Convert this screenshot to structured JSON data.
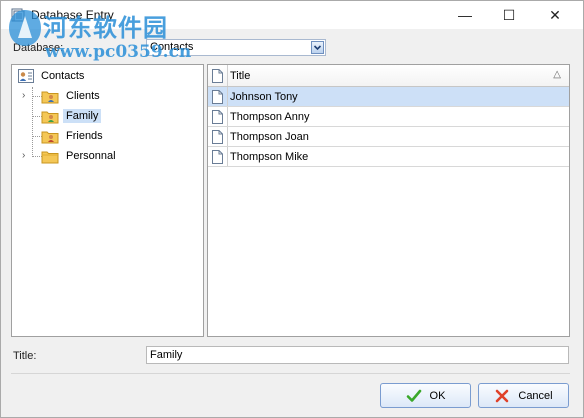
{
  "window": {
    "title": "Database Entry",
    "controls": {
      "minimize": "—",
      "maximize": "☐",
      "close": "✕"
    }
  },
  "watermark": {
    "cn_text": "河东软件园",
    "url": "www.pc0359.cn"
  },
  "database": {
    "label": "Database:",
    "selected": "Contacts"
  },
  "tree": {
    "root": {
      "label": "Contacts",
      "icon": "contacts-icon"
    },
    "children": [
      {
        "label": "Clients",
        "icon": "folder-group-icon",
        "expandable": true,
        "selected": false
      },
      {
        "label": "Family",
        "icon": "folder-group-icon",
        "expandable": false,
        "selected": true
      },
      {
        "label": "Friends",
        "icon": "folder-group-icon",
        "expandable": false,
        "selected": false
      },
      {
        "label": "Personnal",
        "icon": "folder-icon",
        "expandable": true,
        "selected": false
      }
    ]
  },
  "list": {
    "column_title": "Title",
    "sort_indicator": "△",
    "rows": [
      "Johnson Tony",
      "Thompson Anny",
      "Thompson Joan",
      "Thompson Mike"
    ],
    "selected_index": 0
  },
  "title_field": {
    "label": "Title:",
    "value": "Family"
  },
  "buttons": {
    "ok": "OK",
    "cancel": "Cancel"
  },
  "colors": {
    "selection": "#cde0f7",
    "accent": "#7a9cd0",
    "ok_check": "#3aa82a",
    "cancel_x": "#e0412a",
    "watermark": "#2a8fd8"
  }
}
